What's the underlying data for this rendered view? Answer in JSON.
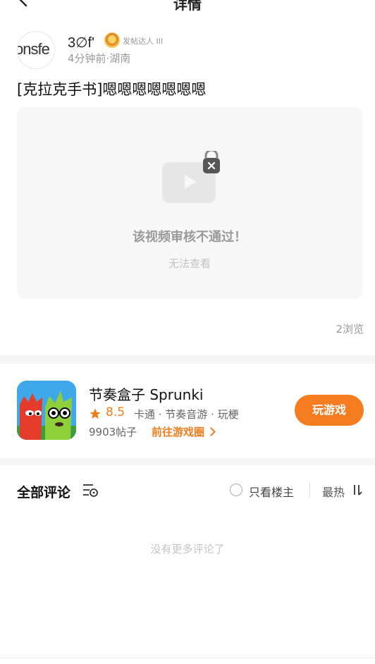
{
  "header": {
    "title": "详情"
  },
  "author": {
    "avatar_text": "onsfe",
    "name": "3∅f'",
    "badge_label": "发帖达人 III",
    "meta": "4分钟前·湖南"
  },
  "post": {
    "title": "[克拉克手书]嗯嗯嗯嗯嗯嗯嗯",
    "video_status": "该视频审核不通过！",
    "video_sub": "无法查看",
    "views": "2浏览"
  },
  "game": {
    "name": "节奏盒子 Sprunki",
    "rating": "8.5",
    "tags": "卡通 · 节奏音游 · 玩梗",
    "posts": "9903帖子",
    "goto_label": "前往游戏圈",
    "play_label": "玩游戏"
  },
  "comments": {
    "title": "全部评论",
    "only_owner_label": "只看楼主",
    "sort_label": "最热",
    "empty_text": "没有更多评论了"
  },
  "colors": {
    "accent": "#f57c1f",
    "muted": "#999999",
    "band": "#f5f5f5"
  }
}
